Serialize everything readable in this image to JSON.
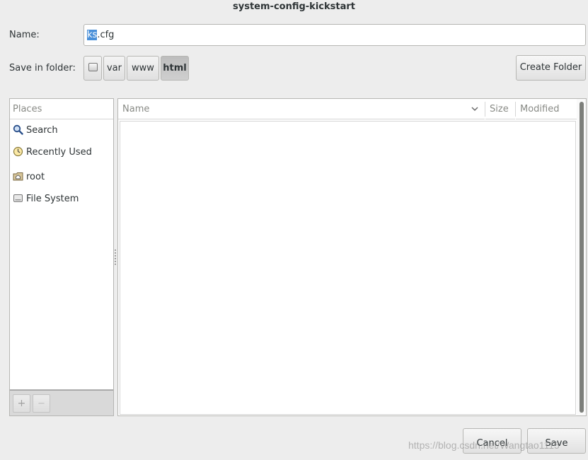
{
  "window": {
    "title": "system-config-kickstart"
  },
  "name_field": {
    "label": "Name:",
    "value_selected": "ks",
    "value_rest": ".cfg"
  },
  "folder": {
    "label": "Save in folder:",
    "path": [
      {
        "icon": "drive-icon"
      },
      {
        "label": "var"
      },
      {
        "label": "www"
      },
      {
        "label": "html",
        "active": true
      }
    ],
    "create_folder_label": "Create Folder"
  },
  "places": {
    "header": "Places",
    "items": [
      {
        "label": "Search",
        "icon": "search-icon"
      },
      {
        "label": "Recently Used",
        "icon": "recent-clock-icon"
      },
      {
        "label": "root",
        "icon": "home-folder-icon"
      },
      {
        "label": "File System",
        "icon": "drive-icon"
      }
    ],
    "add_label": "+",
    "remove_label": "—"
  },
  "file_list": {
    "columns": {
      "name": "Name",
      "size": "Size",
      "modified": "Modified"
    },
    "rows": []
  },
  "buttons": {
    "cancel": "Cancel",
    "save": "Save"
  },
  "watermark": "https://blog.csdn.net/Wangtao1115",
  "colors": {
    "selection": "#4a90d9",
    "background": "#ededed",
    "active_path": "#c4c4c4"
  }
}
